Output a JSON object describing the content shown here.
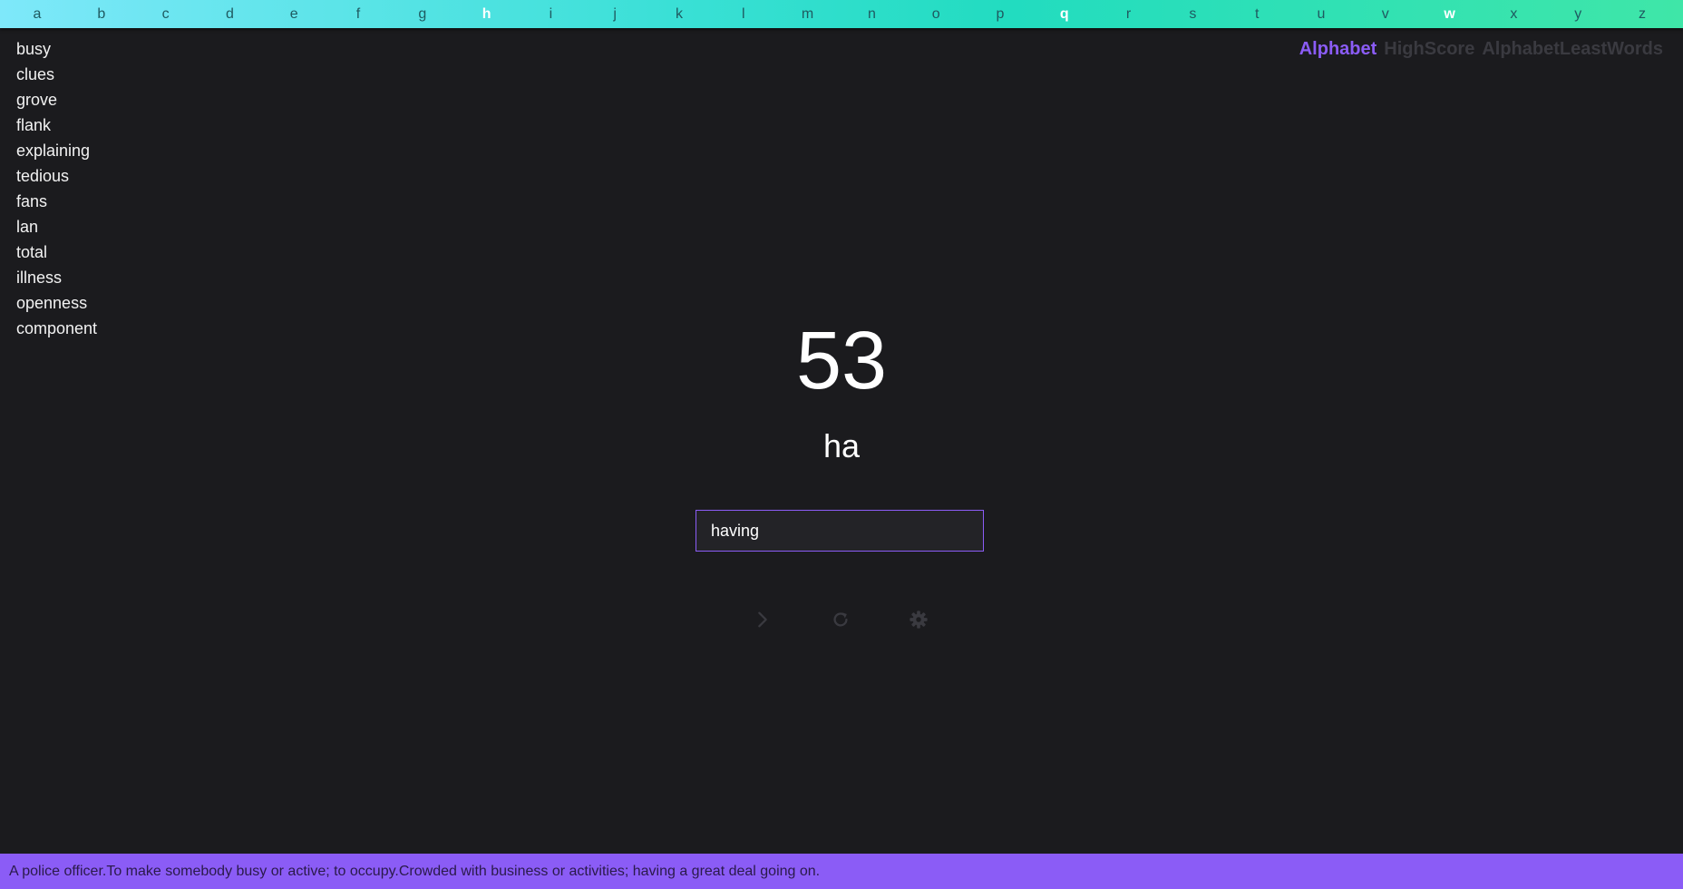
{
  "alphabet": {
    "letters": [
      "a",
      "b",
      "c",
      "d",
      "e",
      "f",
      "g",
      "h",
      "i",
      "j",
      "k",
      "l",
      "m",
      "n",
      "o",
      "p",
      "q",
      "r",
      "s",
      "t",
      "u",
      "v",
      "w",
      "x",
      "y",
      "z"
    ],
    "active_letters": [
      "h",
      "q",
      "w"
    ]
  },
  "words": [
    "busy",
    "clues",
    "grove",
    "flank",
    "explaining",
    "tedious",
    "fans",
    "lan",
    "total",
    "illness",
    "openness",
    "component"
  ],
  "modes": {
    "items": [
      "Alphabet",
      "HighScore",
      "AlphabetLeastWords"
    ],
    "active": "Alphabet"
  },
  "game": {
    "score": "53",
    "prefix": "ha",
    "input_value": "having"
  },
  "controls": {
    "next_icon": "chevron-right-icon",
    "restart_icon": "refresh-icon",
    "settings_icon": "gear-icon"
  },
  "footer": {
    "definition": "A police officer.To make somebody busy or active; to occupy.Crowded with business or activities; having a great deal going on."
  },
  "colors": {
    "accent": "#8b5cf6",
    "background": "#1b1b1e",
    "bar_start": "#7ee8fa",
    "bar_end": "#3fe6a8"
  }
}
